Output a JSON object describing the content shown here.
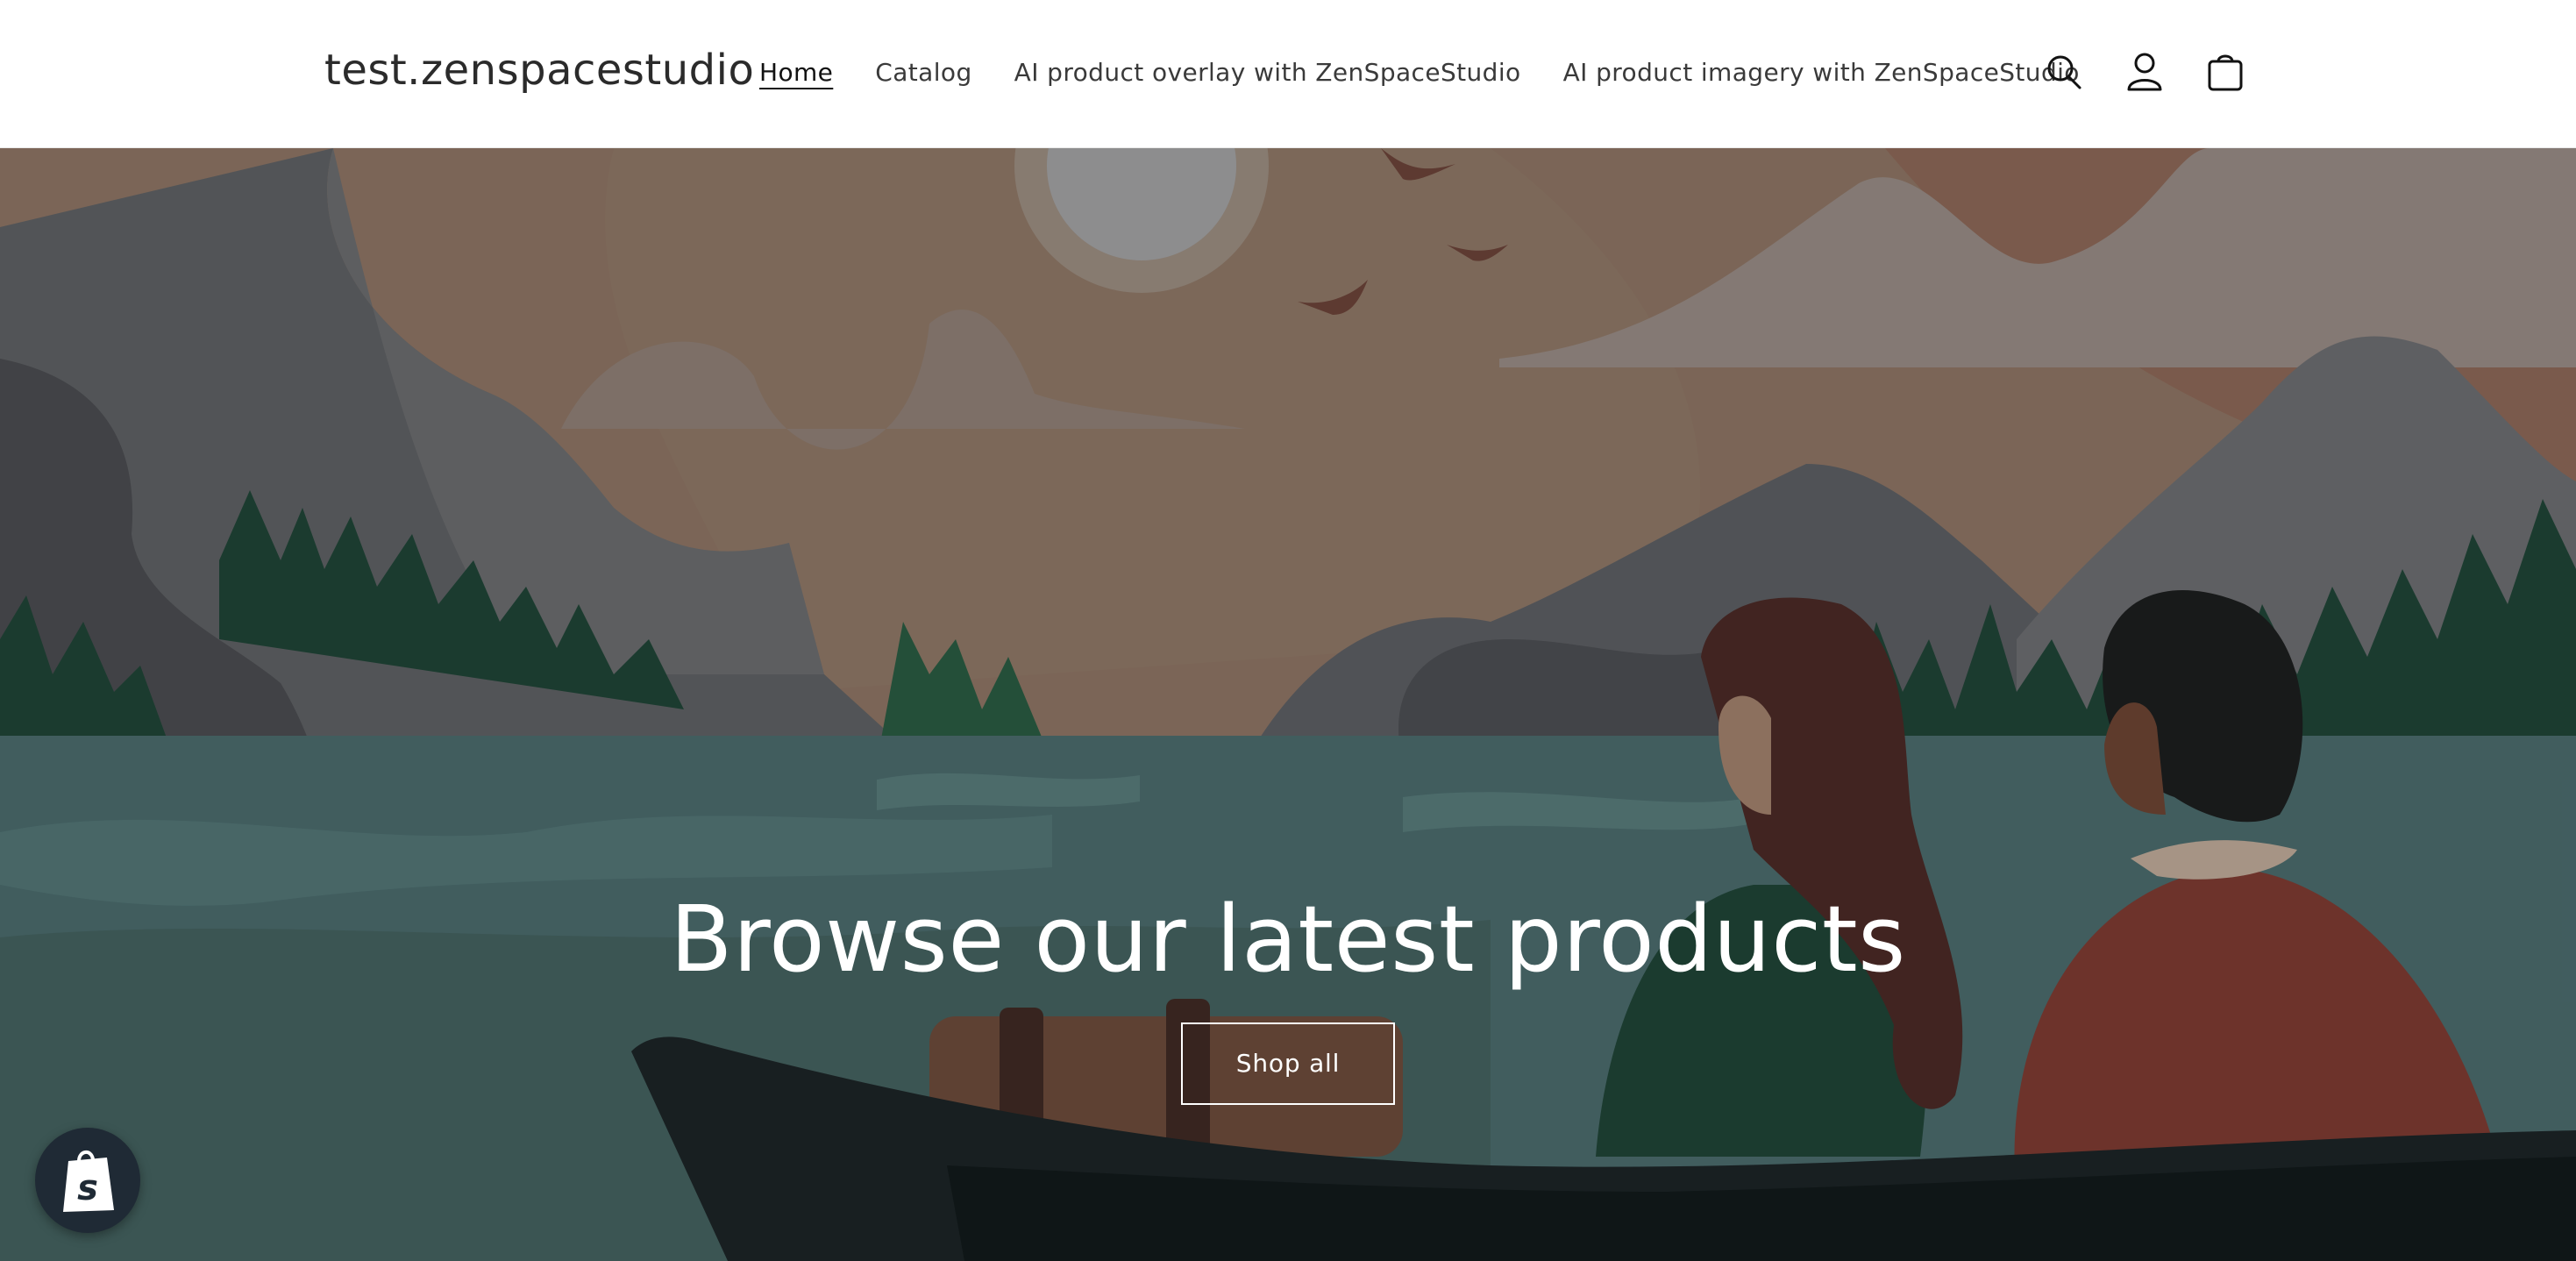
{
  "header": {
    "logo": "test.zenspacestudio",
    "nav": [
      {
        "label": "Home",
        "active": true
      },
      {
        "label": "Catalog",
        "active": false
      },
      {
        "label": "AI product overlay with ZenSpaceStudio",
        "active": false
      },
      {
        "label": "AI product imagery with ZenSpaceStudio",
        "active": false
      }
    ],
    "icons": [
      "search-icon",
      "account-icon",
      "cart-icon"
    ]
  },
  "hero": {
    "title": "Browse our latest products",
    "button_label": "Shop all"
  },
  "badge": {
    "icon": "shopify-bag-icon"
  },
  "colors": {
    "sky": "#8a7262",
    "water": "#4a6b6d",
    "mountain": "#5f6368",
    "trees": "#1f4436",
    "boat": "#1c2426"
  }
}
